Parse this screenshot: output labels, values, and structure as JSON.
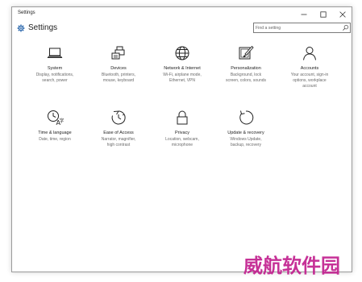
{
  "window": {
    "title": "Settings"
  },
  "header": {
    "title": "Settings",
    "gear_icon": "gear-icon"
  },
  "search": {
    "placeholder": "Find a setting",
    "value": "",
    "icon": "search-icon"
  },
  "categories": [
    {
      "title": "System",
      "icon": "laptop-icon",
      "desc": [
        "Display, notifications,",
        "search, power"
      ]
    },
    {
      "title": "Devices",
      "icon": "printer-keyboard-icon",
      "desc": [
        "Bluetooth, printers,",
        "mouse, keyboard"
      ]
    },
    {
      "title": "Network & Internet",
      "icon": "globe-icon",
      "desc": [
        "Wi-Fi, airplane mode,",
        "Ethernet, VPN"
      ]
    },
    {
      "title": "Personalization",
      "icon": "paint-brush-icon",
      "desc": [
        "Background, lock",
        "screen, colors, sounds"
      ]
    },
    {
      "title": "Accounts",
      "icon": "person-icon",
      "desc": [
        "Your account, sign-in",
        "options, workplace",
        "account"
      ]
    },
    {
      "title": "Time & language",
      "icon": "time-language-icon",
      "desc": [
        "Date, time, region"
      ]
    },
    {
      "title": "Ease of Access",
      "icon": "ease-of-access-icon",
      "desc": [
        "Narrator, magnifier,",
        "high contrast"
      ]
    },
    {
      "title": "Privacy",
      "icon": "lock-icon",
      "desc": [
        "Location, webcam,",
        "microphone"
      ]
    },
    {
      "title": "Update & recovery",
      "icon": "refresh-icon",
      "desc": [
        "Windows Update,",
        "backup, recovery"
      ]
    }
  ],
  "watermark": {
    "text": "威航软件园"
  },
  "colors": {
    "accent": "#1f5fa8",
    "watermark": "#c2208f"
  }
}
